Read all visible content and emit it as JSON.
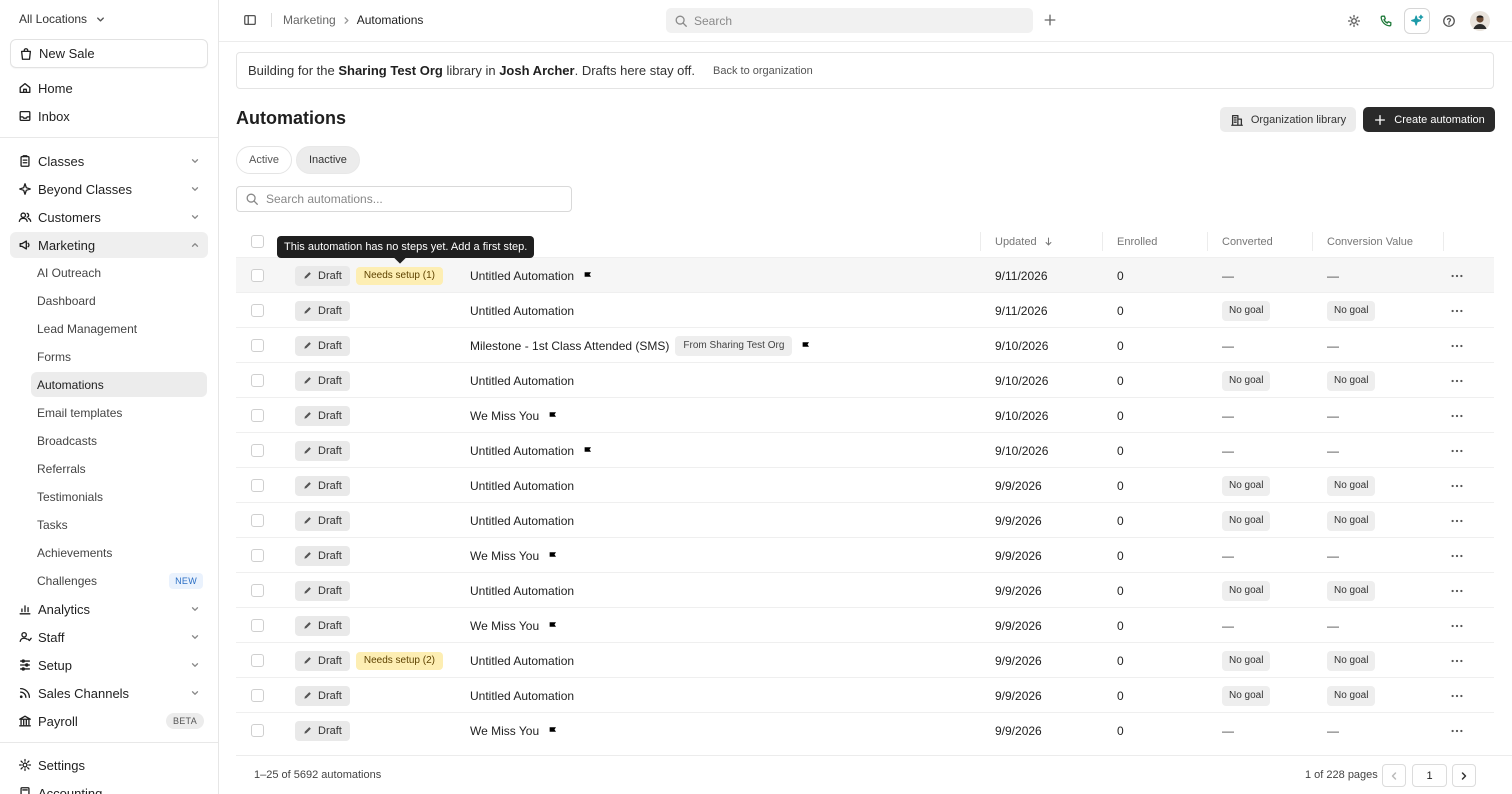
{
  "sidebar": {
    "location": "All Locations",
    "new_sale": "New Sale",
    "home": "Home",
    "inbox": "Inbox",
    "classes": "Classes",
    "beyond_classes": "Beyond Classes",
    "customers": "Customers",
    "marketing": "Marketing",
    "marketing_items": [
      "AI Outreach",
      "Dashboard",
      "Lead Management",
      "Forms",
      "Automations",
      "Email templates",
      "Broadcasts",
      "Referrals",
      "Testimonials",
      "Tasks",
      "Achievements",
      "Challenges"
    ],
    "challenges_badge": "NEW",
    "analytics": "Analytics",
    "staff": "Staff",
    "setup": "Setup",
    "sales_channels": "Sales Channels",
    "payroll": "Payroll",
    "payroll_badge": "BETA",
    "settings": "Settings",
    "accounting": "Accounting"
  },
  "topbar": {
    "crumb_parent": "Marketing",
    "crumb_current": "Automations",
    "search_placeholder": "Search"
  },
  "banner": {
    "t1": "Building for the ",
    "org": "Sharing Test Org",
    "t2": " library in ",
    "user": "Josh Archer",
    "t3": ". Drafts here stay off.",
    "back": "Back to organization"
  },
  "page": {
    "title": "Automations",
    "org_library": "Organization library",
    "create": "Create automation",
    "tab_active": "Active",
    "tab_inactive": "Inactive",
    "search_placeholder": "Search automations..."
  },
  "table": {
    "headers": {
      "updated": "Updated",
      "enrolled": "Enrolled",
      "converted": "Converted",
      "conversion_value": "Conversion Value"
    },
    "tooltip": "This automation has no steps yet. Add a first step.",
    "rows": [
      {
        "status": "Draft",
        "needs": "Needs setup (1)",
        "name": "Untitled Automation",
        "from": "",
        "flag": true,
        "updated": "9/11/2026",
        "enrolled": "0",
        "converted": "—",
        "value": "—"
      },
      {
        "status": "Draft",
        "needs": "",
        "name": "Untitled Automation",
        "from": "",
        "flag": false,
        "updated": "9/11/2026",
        "enrolled": "0",
        "converted": "No goal",
        "value": "No goal"
      },
      {
        "status": "Draft",
        "needs": "",
        "name": "Milestone - 1st Class Attended (SMS)",
        "from": "From Sharing Test Org",
        "flag": true,
        "updated": "9/10/2026",
        "enrolled": "0",
        "converted": "—",
        "value": "—"
      },
      {
        "status": "Draft",
        "needs": "",
        "name": "Untitled Automation",
        "from": "",
        "flag": false,
        "updated": "9/10/2026",
        "enrolled": "0",
        "converted": "No goal",
        "value": "No goal"
      },
      {
        "status": "Draft",
        "needs": "",
        "name": "We Miss You",
        "from": "",
        "flag": true,
        "updated": "9/10/2026",
        "enrolled": "0",
        "converted": "—",
        "value": "—"
      },
      {
        "status": "Draft",
        "needs": "",
        "name": "Untitled Automation",
        "from": "",
        "flag": true,
        "updated": "9/10/2026",
        "enrolled": "0",
        "converted": "—",
        "value": "—"
      },
      {
        "status": "Draft",
        "needs": "",
        "name": "Untitled Automation",
        "from": "",
        "flag": false,
        "updated": "9/9/2026",
        "enrolled": "0",
        "converted": "No goal",
        "value": "No goal"
      },
      {
        "status": "Draft",
        "needs": "",
        "name": "Untitled Automation",
        "from": "",
        "flag": false,
        "updated": "9/9/2026",
        "enrolled": "0",
        "converted": "No goal",
        "value": "No goal"
      },
      {
        "status": "Draft",
        "needs": "",
        "name": "We Miss You",
        "from": "",
        "flag": true,
        "updated": "9/9/2026",
        "enrolled": "0",
        "converted": "—",
        "value": "—"
      },
      {
        "status": "Draft",
        "needs": "",
        "name": "Untitled Automation",
        "from": "",
        "flag": false,
        "updated": "9/9/2026",
        "enrolled": "0",
        "converted": "No goal",
        "value": "No goal"
      },
      {
        "status": "Draft",
        "needs": "",
        "name": "We Miss You",
        "from": "",
        "flag": true,
        "updated": "9/9/2026",
        "enrolled": "0",
        "converted": "—",
        "value": "—"
      },
      {
        "status": "Draft",
        "needs": "Needs setup (2)",
        "name": "Untitled Automation",
        "from": "",
        "flag": false,
        "updated": "9/9/2026",
        "enrolled": "0",
        "converted": "No goal",
        "value": "No goal"
      },
      {
        "status": "Draft",
        "needs": "",
        "name": "Untitled Automation",
        "from": "",
        "flag": false,
        "updated": "9/9/2026",
        "enrolled": "0",
        "converted": "No goal",
        "value": "No goal"
      },
      {
        "status": "Draft",
        "needs": "",
        "name": "We Miss You",
        "from": "",
        "flag": true,
        "updated": "9/9/2026",
        "enrolled": "0",
        "converted": "—",
        "value": "—"
      }
    ]
  },
  "footer": {
    "count": "1–25 of 5692 automations",
    "pages": "1 of 228 pages",
    "page": "1"
  }
}
